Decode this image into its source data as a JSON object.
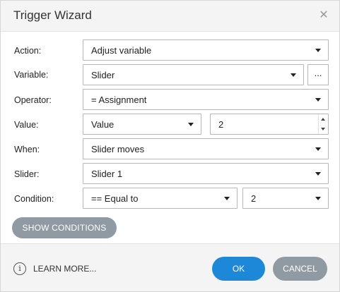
{
  "window": {
    "title": "Trigger Wizard",
    "close_glyph": "✕"
  },
  "labels": {
    "action": "Action:",
    "variable": "Variable:",
    "operator": "Operator:",
    "value": "Value:",
    "when": "When:",
    "slider": "Slider:",
    "condition": "Condition:"
  },
  "fields": {
    "action": "Adjust variable",
    "variable": "Slider",
    "variable_more": "...",
    "operator": "= Assignment",
    "value_type": "Value",
    "value_number": "2",
    "when": "Slider moves",
    "slider": "Slider 1",
    "condition_operator": "== Equal to",
    "condition_value": "2"
  },
  "buttons": {
    "show_conditions": "SHOW CONDITIONS",
    "learn_more": "LEARN MORE...",
    "ok": "OK",
    "cancel": "CANCEL"
  },
  "icons": {
    "info": "i",
    "dropdown": "chevron-down-icon",
    "spinner": "spin-updown-icon"
  },
  "colors": {
    "primary": "#1e88d8",
    "secondary": "#8f9aa3",
    "border": "#b7b7b7",
    "header_bg": "#f4f4f4"
  }
}
